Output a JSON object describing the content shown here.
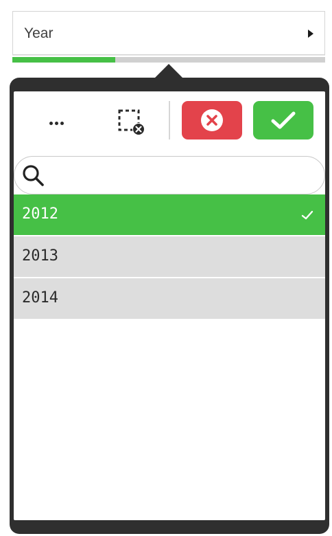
{
  "filter": {
    "title": "Year",
    "selected_ratio": 0.33
  },
  "toolbar": {
    "more_icon": "more-horizontal-icon",
    "clear_selection_icon": "clear-selection-icon",
    "cancel_icon": "close-circle-icon",
    "confirm_icon": "checkmark-icon"
  },
  "search": {
    "value": "",
    "placeholder": "",
    "icon": "search-icon"
  },
  "list": {
    "items": [
      {
        "label": "2012",
        "state": "selected"
      },
      {
        "label": "2013",
        "state": "alternative"
      },
      {
        "label": "2014",
        "state": "alternative"
      }
    ]
  },
  "colors": {
    "selected": "#46c046",
    "alternative": "#dddddd",
    "cancel": "#e3434b",
    "confirm": "#46c046",
    "popover_frame": "#2f2f2f"
  }
}
